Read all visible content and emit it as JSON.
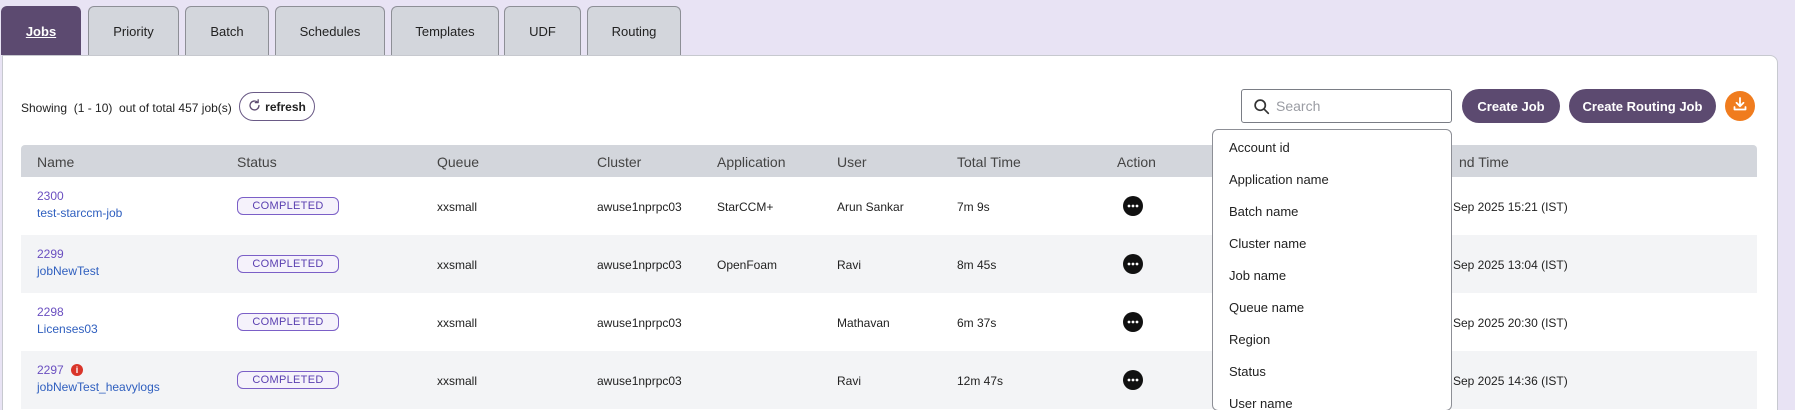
{
  "tabs": [
    {
      "label": "Jobs",
      "active": true
    },
    {
      "label": "Priority",
      "active": false
    },
    {
      "label": "Batch",
      "active": false
    },
    {
      "label": "Schedules",
      "active": false
    },
    {
      "label": "Templates",
      "active": false
    },
    {
      "label": "UDF",
      "active": false
    },
    {
      "label": "Routing",
      "active": false
    }
  ],
  "toolbar": {
    "showing_text": "Showing  (1 - 10)  out of total 457 job(s)",
    "refresh_label": "refresh",
    "search_placeholder": "Search",
    "create_job_label": "Create Job",
    "create_routing_job_label": "Create Routing Job"
  },
  "table": {
    "headers": [
      "Name",
      "Status",
      "Queue",
      "Cluster",
      "Application",
      "User",
      "Total Time",
      "Action",
      "nd Time"
    ],
    "rows": [
      {
        "id": "2300",
        "name": "test-starccm-job",
        "status": "COMPLETED",
        "queue": "xxsmall",
        "cluster": "awuse1nprpc03",
        "application": "StarCCM+",
        "user": "Arun Sankar",
        "total_time": "7m 9s",
        "end_time": "Sep 2025 15:21 (IST)",
        "info": false
      },
      {
        "id": "2299",
        "name": "jobNewTest",
        "status": "COMPLETED",
        "queue": "xxsmall",
        "cluster": "awuse1nprpc03",
        "application": "OpenFoam",
        "user": "Ravi",
        "total_time": "8m 45s",
        "end_time": "Sep 2025 13:04 (IST)",
        "info": false
      },
      {
        "id": "2298",
        "name": "Licenses03",
        "status": "COMPLETED",
        "queue": "xxsmall",
        "cluster": "awuse1nprpc03",
        "application": "",
        "user": "Mathavan",
        "total_time": "6m 37s",
        "end_time": "Sep 2025 20:30 (IST)",
        "info": false
      },
      {
        "id": "2297",
        "name": "jobNewTest_heavylogs",
        "status": "COMPLETED",
        "queue": "xxsmall",
        "cluster": "awuse1nprpc03",
        "application": "",
        "user": "Ravi",
        "total_time": "12m 47s",
        "end_time": "Sep 2025 14:36 (IST)",
        "info": true
      }
    ]
  },
  "search_dropdown": {
    "options": [
      "Account id",
      "Application name",
      "Batch name",
      "Cluster name",
      "Job name",
      "Queue name",
      "Region",
      "Status",
      "User name"
    ]
  },
  "colors": {
    "accent": "#5c4a70",
    "download": "#f07c1e",
    "status_border": "#7b5fc7",
    "info": "#d9352a"
  }
}
